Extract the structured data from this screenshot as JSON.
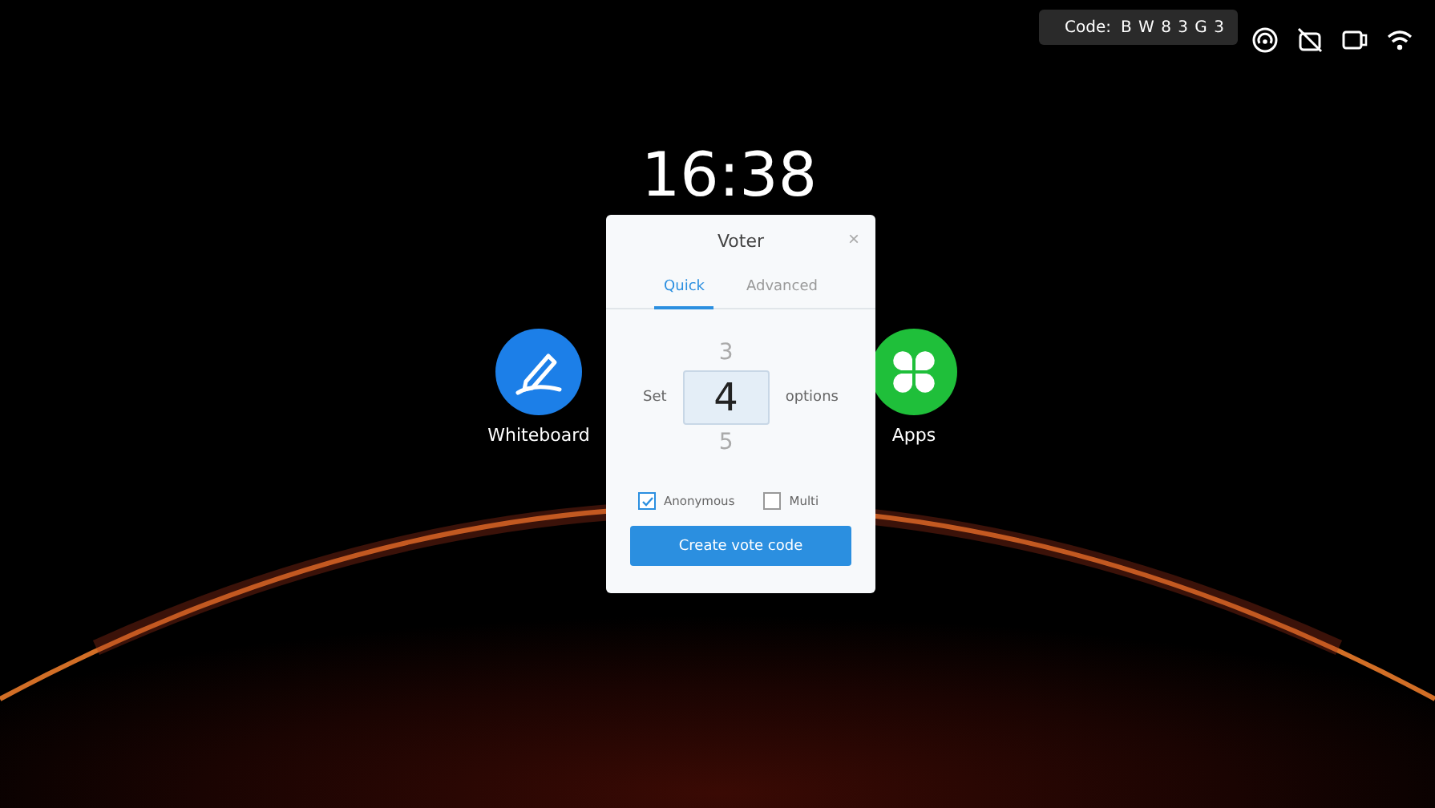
{
  "status_bar": {
    "code_label": "Code:",
    "code": "B W 8 3 G 3"
  },
  "clock": "16:38",
  "desktop_icons": [
    {
      "kind": "whiteboard",
      "label": "Whiteboard"
    },
    {
      "kind": "apps",
      "label": "Apps"
    }
  ],
  "dialog": {
    "title": "Voter",
    "close": "×",
    "tabs": [
      {
        "label": "Quick",
        "selected": true
      },
      {
        "label": "Advanced",
        "selected": false
      }
    ],
    "picker": {
      "prefix": "Set",
      "suffix": "options",
      "above": "3",
      "value": "4",
      "below": "5"
    },
    "options": [
      {
        "label": "Anonymous",
        "checked": true
      },
      {
        "label": "Multi",
        "checked": false
      }
    ],
    "button": "Create vote code"
  }
}
